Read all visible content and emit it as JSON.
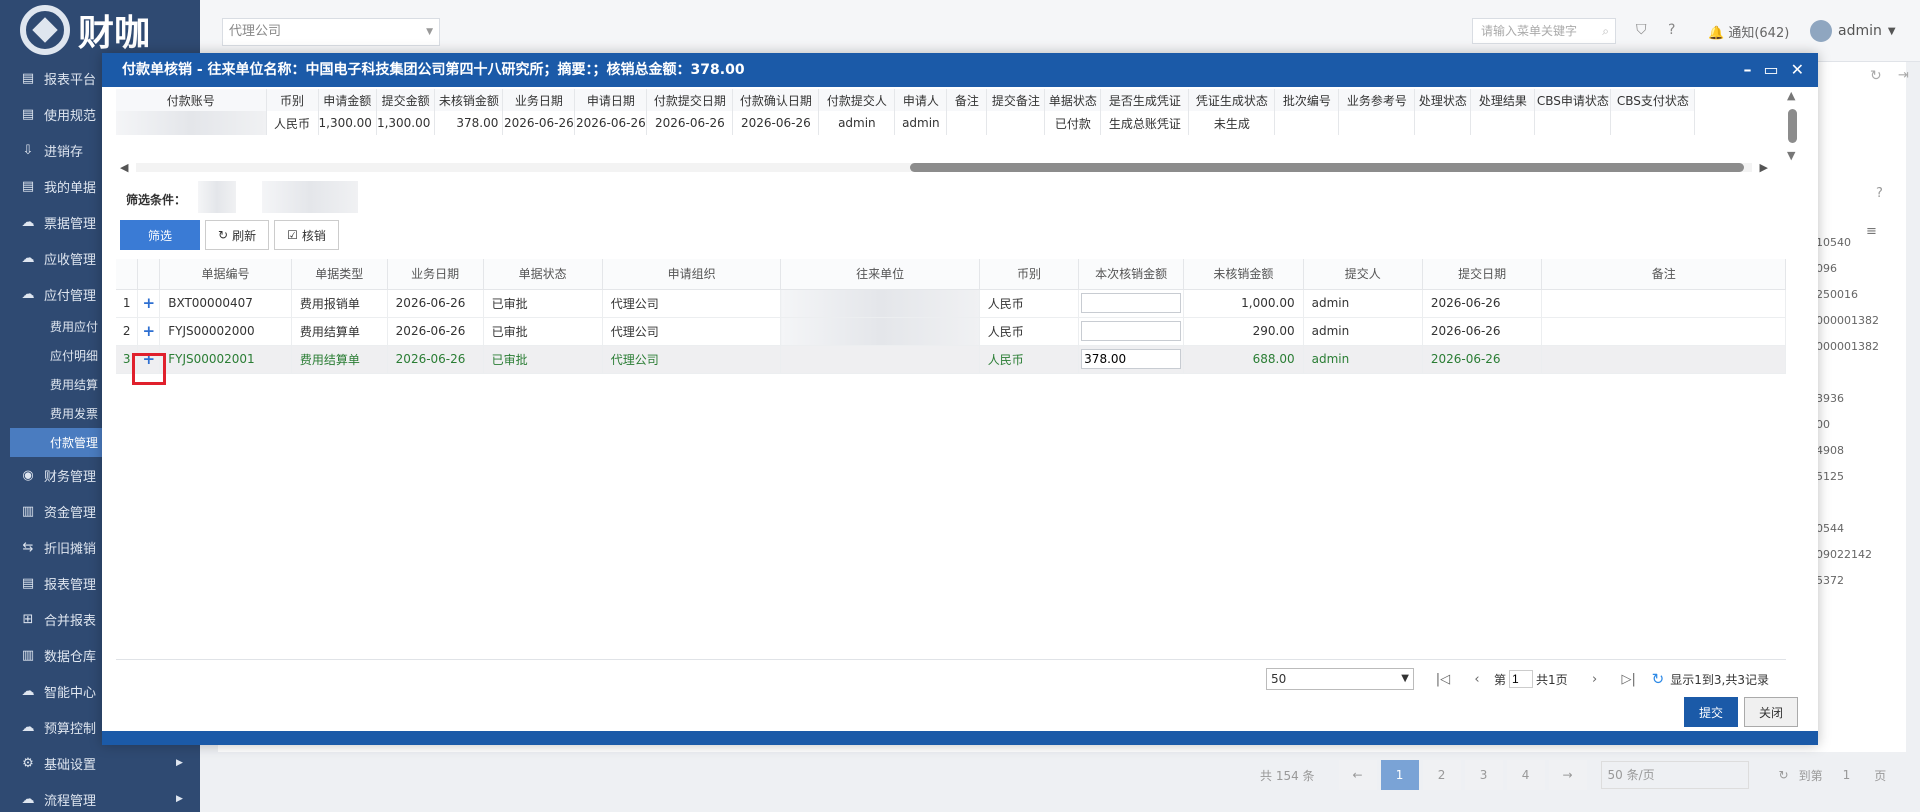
{
  "app": {
    "brand": "财咖"
  },
  "topbar": {
    "company": "代理公司",
    "search_placeholder": "请输入菜单关键字",
    "notice": "通知(642)",
    "user": "admin"
  },
  "sidebar": {
    "items": [
      {
        "icon": "▤",
        "label": "报表平台"
      },
      {
        "icon": "▤",
        "label": "使用规范"
      },
      {
        "icon": "⇩",
        "label": "进销存"
      },
      {
        "icon": "▤",
        "label": "我的单据"
      },
      {
        "icon": "☁",
        "label": "票据管理"
      },
      {
        "icon": "☁",
        "label": "应收管理"
      },
      {
        "icon": "☁",
        "label": "应付管理"
      }
    ],
    "subitems": [
      "费用应付",
      "应付明细",
      "费用结算",
      "费用发票",
      "付款管理"
    ],
    "items2": [
      {
        "icon": "◉",
        "label": "财务管理"
      },
      {
        "icon": "▥",
        "label": "资金管理"
      },
      {
        "icon": "⇆",
        "label": "折旧摊销"
      },
      {
        "icon": "▤",
        "label": "报表管理"
      },
      {
        "icon": "⊞",
        "label": "合并报表"
      },
      {
        "icon": "▥",
        "label": "数据仓库"
      },
      {
        "icon": "☁",
        "label": "智能中心"
      },
      {
        "icon": "☁",
        "label": "预算控制"
      },
      {
        "icon": "⚙",
        "label": "基础设置"
      },
      {
        "icon": "☁",
        "label": "流程管理"
      }
    ]
  },
  "background": {
    "right_values": [
      "10540",
      "096",
      "250016",
      "000001382",
      "000001382",
      "",
      "3936",
      "00",
      "4908",
      "5125",
      "",
      "0544",
      "09022142",
      "5372"
    ],
    "pager": {
      "total": "共 154 条",
      "pages": [
        "1",
        "2",
        "3",
        "4"
      ],
      "size": "50 条/页",
      "goto_label": "到第",
      "goto_value": "1",
      "page_suffix": "页"
    }
  },
  "modal": {
    "title": "付款单核销 - 往来单位名称：中国电子科技集团公司第四十八研究所；摘要：；核销总金额：378.00",
    "top_table": {
      "headers": [
        "付款账号",
        "币别",
        "申请金额",
        "提交金额",
        "未核销金额",
        "业务日期",
        "申请日期",
        "付款提交日期",
        "付款确认日期",
        "付款提交人",
        "申请人",
        "备注",
        "提交备注",
        "单据状态",
        "是否生成凭证",
        "凭证生成状态",
        "批次编号",
        "业务参考号",
        "处理状态",
        "处理结果",
        "CBS申请状态",
        "CBS支付状态"
      ],
      "row": [
        "",
        "人民币",
        "1,300.00",
        "1,300.00",
        "378.00",
        "2026-06-26",
        "2026-06-26",
        "2026-06-26",
        "2026-06-26",
        "admin",
        "admin",
        "",
        "",
        "已付款",
        "生成总账凭证",
        "未生成",
        "",
        "",
        "",
        "",
        "",
        ""
      ]
    },
    "filter_label": "筛选条件：",
    "buttons": {
      "filter": "筛选",
      "refresh": "刷新",
      "verify": "核销"
    },
    "grid": {
      "headers": [
        "",
        "",
        "单据编号",
        "单据类型",
        "业务日期",
        "单据状态",
        "申请组织",
        "往来单位",
        "币别",
        "本次核销金额",
        "未核销金额",
        "提交人",
        "提交日期",
        "备注"
      ],
      "rows": [
        {
          "no": "1",
          "code": "BXT00000407",
          "type": "费用报销单",
          "date": "2026-06-26",
          "status": "已审批",
          "org": "代理公司",
          "currency": "人民币",
          "amount": "",
          "unverified": "1,000.00",
          "submitter": "admin",
          "submit_date": "2026-06-26",
          "remark": ""
        },
        {
          "no": "2",
          "code": "FYJS00002000",
          "type": "费用结算单",
          "date": "2026-06-26",
          "status": "已审批",
          "org": "代理公司",
          "currency": "人民币",
          "amount": "",
          "unverified": "290.00",
          "submitter": "admin",
          "submit_date": "2026-06-26",
          "remark": ""
        },
        {
          "no": "3",
          "code": "FYJS00002001",
          "type": "费用结算单",
          "date": "2026-06-26",
          "status": "已审批",
          "org": "代理公司",
          "currency": "人民币",
          "amount": "378.00",
          "unverified": "688.00",
          "submitter": "admin",
          "submit_date": "2026-06-26",
          "remark": ""
        }
      ]
    },
    "pager": {
      "page_size": "50",
      "page_prefix": "第",
      "page": "1",
      "page_total": "共1页",
      "summary": "显示1到3,共3记录"
    },
    "submit": "提交",
    "close": "关闭"
  }
}
